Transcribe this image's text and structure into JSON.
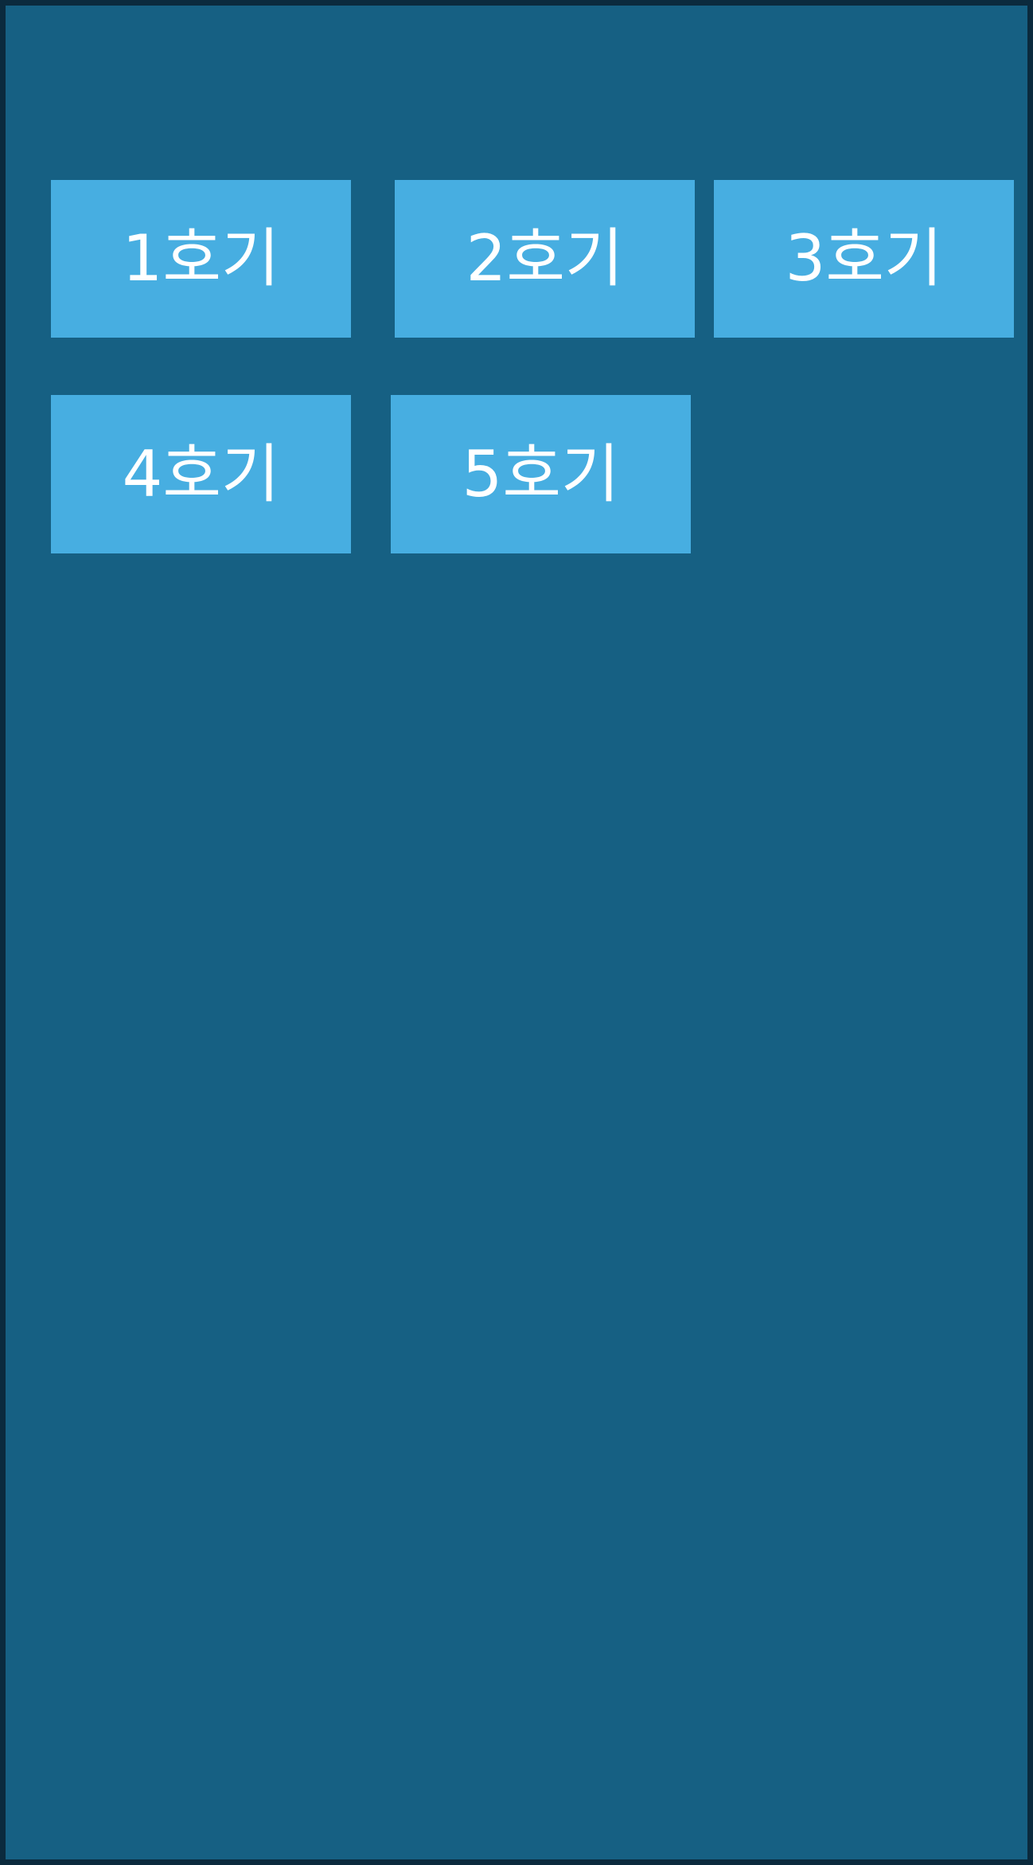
{
  "colors": {
    "frame": "#0b2a3d",
    "background": "#166083",
    "tile": "#47aee1",
    "tile_text": "#ffffff"
  },
  "units": [
    {
      "label": "1호기"
    },
    {
      "label": "2호기"
    },
    {
      "label": "3호기"
    },
    {
      "label": "4호기"
    },
    {
      "label": "5호기"
    }
  ]
}
